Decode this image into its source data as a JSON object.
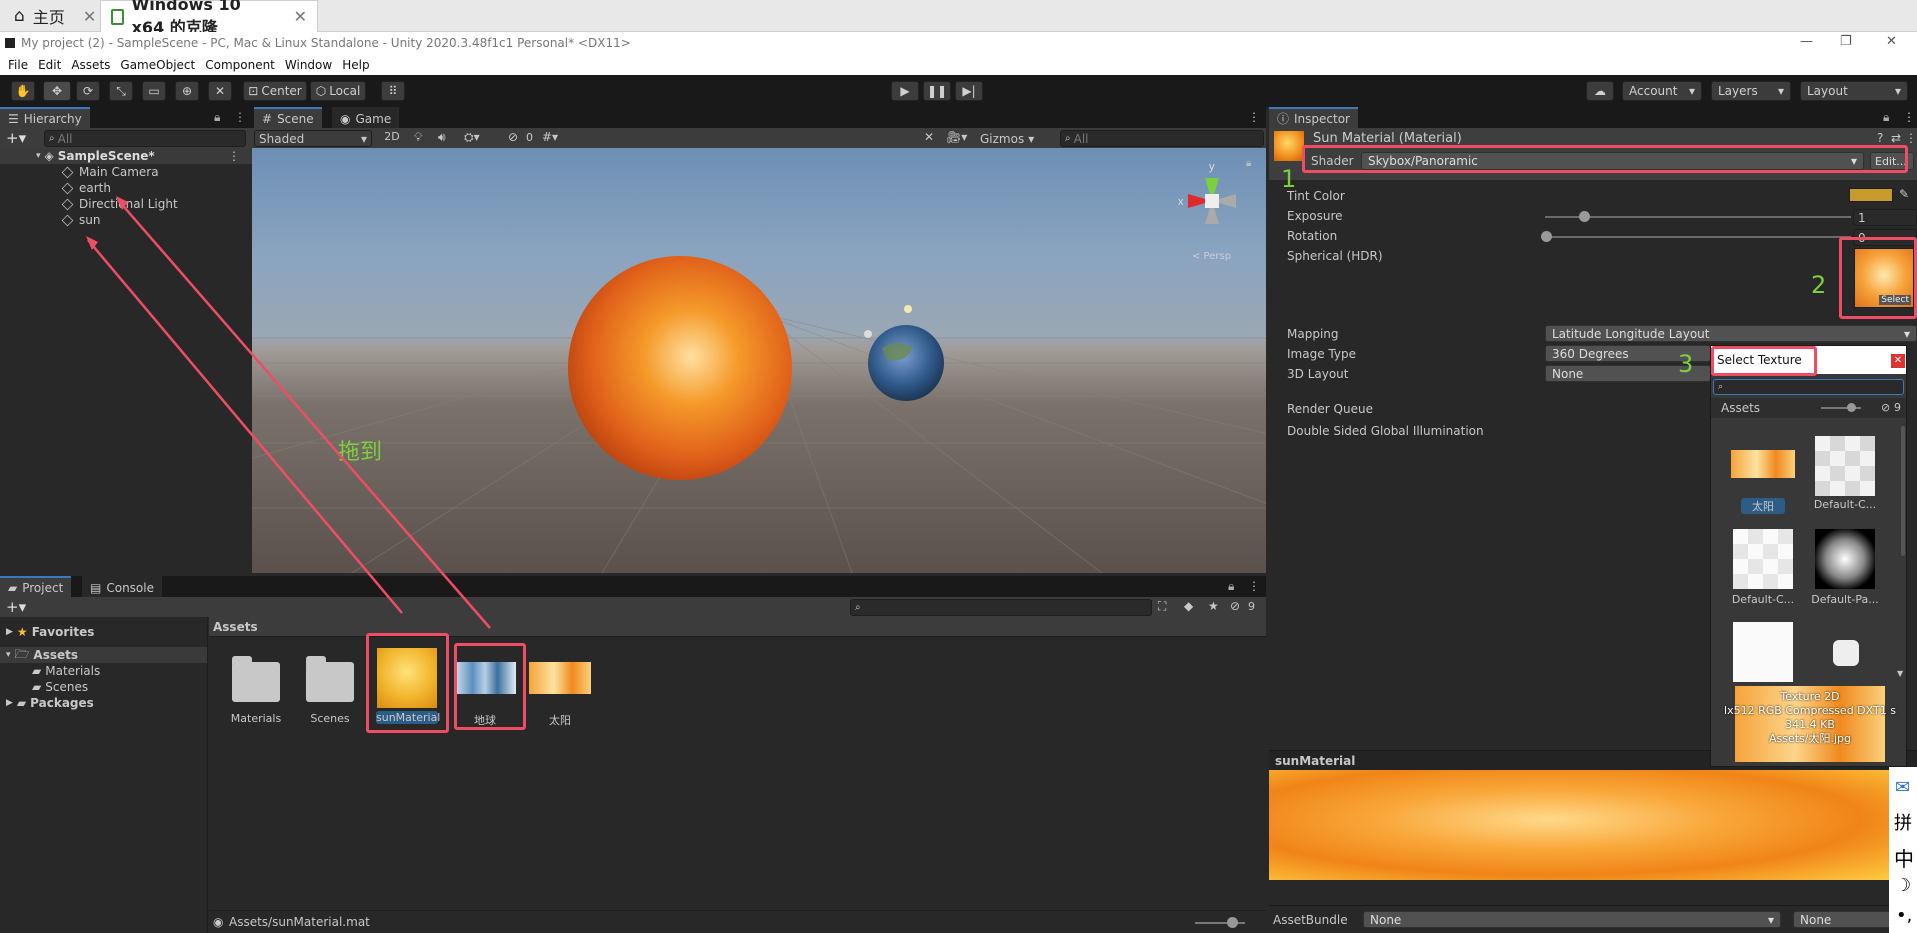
{
  "vm_tabs": {
    "home": "主页",
    "active": "Windows 10 x64 的克隆"
  },
  "window": {
    "title": "My project (2) - SampleScene - PC, Mac & Linux Standalone - Unity 2020.3.48f1c1 Personal* <DX11>"
  },
  "menu": [
    "File",
    "Edit",
    "Assets",
    "GameObject",
    "Component",
    "Window",
    "Help"
  ],
  "toolbar": {
    "center": "Center",
    "local": "Local",
    "account": "Account",
    "layers": "Layers",
    "layout": "Layout"
  },
  "hierarchy": {
    "tab": "Hierarchy",
    "search_placeholder": "All",
    "scene": "SampleScene*",
    "items": [
      "Main Camera",
      "earth",
      "Directional Light",
      "sun"
    ]
  },
  "scene_view": {
    "tab_scene": "Scene",
    "tab_game": "Game",
    "shading": "Shaded",
    "mode_2d": "2D",
    "hidden_count": "0",
    "gizmos": "Gizmos",
    "search_placeholder": "All",
    "annotation": "拖到",
    "persp_label": "< Persp"
  },
  "inspector": {
    "tab": "Inspector",
    "material_name": "Sun Material (Material)",
    "shader_label": "Shader",
    "shader_value": "Skybox/Panoramic",
    "edit": "Edit...",
    "props": [
      {
        "label": "Tint Color"
      },
      {
        "label": "Exposure",
        "value": "1"
      },
      {
        "label": "Rotation",
        "value": "0"
      },
      {
        "label": "Spherical  (HDR)"
      },
      {
        "label": "Mapping",
        "value": "Latitude Longitude Layout"
      },
      {
        "label": "Image Type",
        "value": "360 Degrees"
      },
      {
        "label": "3D Layout",
        "value": "None"
      },
      {
        "label": "Render Queue"
      },
      {
        "label": "Double Sided Global Illumination"
      }
    ],
    "select_btn": "Select",
    "preview_title": "sunMaterial",
    "assetbundle_label": "AssetBundle",
    "assetbundle_value": "None",
    "assetbundle_variant": "None",
    "steps": [
      "1",
      "2",
      "3"
    ]
  },
  "select_texture": {
    "title": "Select Texture",
    "assets_tab": "Assets",
    "hidden_count": "9",
    "items": [
      "太阳",
      "Default-C...",
      "Default-C...",
      "Default-Pa..."
    ],
    "info": [
      "Texture 2D",
      "lx512  RGB Compressed DXT1 s",
      "341.4 KB",
      "Assets/太阳.jpg"
    ]
  },
  "project": {
    "tab_project": "Project",
    "tab_console": "Console",
    "hidden_count": "9",
    "favorites": "Favorites",
    "assets": "Assets",
    "tree": [
      "Materials",
      "Scenes"
    ],
    "packages": "Packages",
    "breadcrumb": "Assets",
    "items": [
      "Materials",
      "Scenes",
      "sunMaterial",
      "地球",
      "太阳"
    ],
    "status": "Assets/sunMaterial.mat"
  },
  "ime": [
    "拼",
    "中"
  ],
  "colors": {
    "accent": "#3a79bb",
    "highlight": "#ef4d64",
    "annotation": "#7bd13b",
    "editor_bg": "#282828"
  }
}
